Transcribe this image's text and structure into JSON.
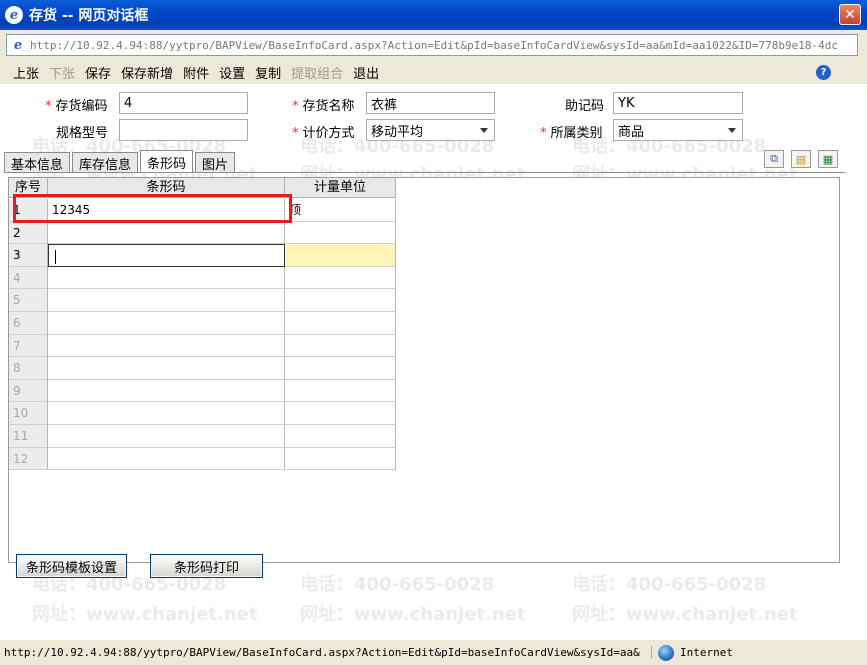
{
  "window": {
    "title": "存货 -- 网页对话框",
    "close_glyph": "✕"
  },
  "address": {
    "url": "http://10.92.4.94:88/yytpro/BAPView/BaseInfoCard.aspx?Action=Edit&pId=baseInfoCardView&sysId=aa&mId=aa1022&ID=778b9e18-4dc"
  },
  "toolbar": {
    "items": [
      {
        "label": "上张",
        "enabled": true
      },
      {
        "label": "下张",
        "enabled": false
      },
      {
        "label": "保存",
        "enabled": true
      },
      {
        "label": "保存新增",
        "enabled": true
      },
      {
        "label": "附件",
        "enabled": true
      },
      {
        "label": "设置",
        "enabled": true
      },
      {
        "label": "复制",
        "enabled": true
      },
      {
        "label": "提取组合",
        "enabled": false
      },
      {
        "label": "退出",
        "enabled": true
      }
    ],
    "help_glyph": "?"
  },
  "form": {
    "code": {
      "label": "存货编码",
      "value": "4"
    },
    "name": {
      "label": "存货名称",
      "value": "衣裤"
    },
    "mnemonic": {
      "label": "助记码",
      "value": "YK"
    },
    "spec": {
      "label": "规格型号",
      "value": ""
    },
    "pricing": {
      "label": "计价方式",
      "value": "移动平均"
    },
    "category": {
      "label": "所属类别",
      "value": "商品"
    },
    "required_mark": "*"
  },
  "tabs": [
    {
      "label": "基本信息",
      "active": false
    },
    {
      "label": "库存信息",
      "active": false
    },
    {
      "label": "条形码",
      "active": true
    },
    {
      "label": "图片",
      "active": false
    }
  ],
  "actions": {
    "copy_glyph": "⧉",
    "paste_glyph": "▤",
    "export_glyph": "▦"
  },
  "grid": {
    "headers": [
      "序号",
      "条形码",
      "计量单位"
    ],
    "rows": [
      {
        "no": "1",
        "barcode": "12345",
        "unit": "顶"
      },
      {
        "no": "2",
        "barcode": "",
        "unit": ""
      },
      {
        "no": "3",
        "barcode": "",
        "unit": ""
      },
      {
        "no": "4",
        "barcode": "",
        "unit": ""
      },
      {
        "no": "5",
        "barcode": "",
        "unit": ""
      },
      {
        "no": "6",
        "barcode": "",
        "unit": ""
      },
      {
        "no": "7",
        "barcode": "",
        "unit": ""
      },
      {
        "no": "8",
        "barcode": "",
        "unit": ""
      },
      {
        "no": "9",
        "barcode": "",
        "unit": ""
      },
      {
        "no": "10",
        "barcode": "",
        "unit": ""
      },
      {
        "no": "11",
        "barcode": "",
        "unit": ""
      },
      {
        "no": "12",
        "barcode": "",
        "unit": ""
      }
    ]
  },
  "buttons": {
    "template_settings": "条形码模板设置",
    "print": "条形码打印"
  },
  "watermark": {
    "phone": "电话：400-665-0028",
    "site": "网址：www.chanjet.net"
  },
  "status": {
    "url": "http://10.92.4.94:88/yytpro/BAPView/BaseInfoCard.aspx?Action=Edit&pId=baseInfoCardView&sysId=aa&",
    "zone": "Internet"
  },
  "colors": {
    "title_bar": "#0048c8",
    "required": "#e53030",
    "highlight": "#e81c1c",
    "editing_cell": "#fff5b8"
  }
}
